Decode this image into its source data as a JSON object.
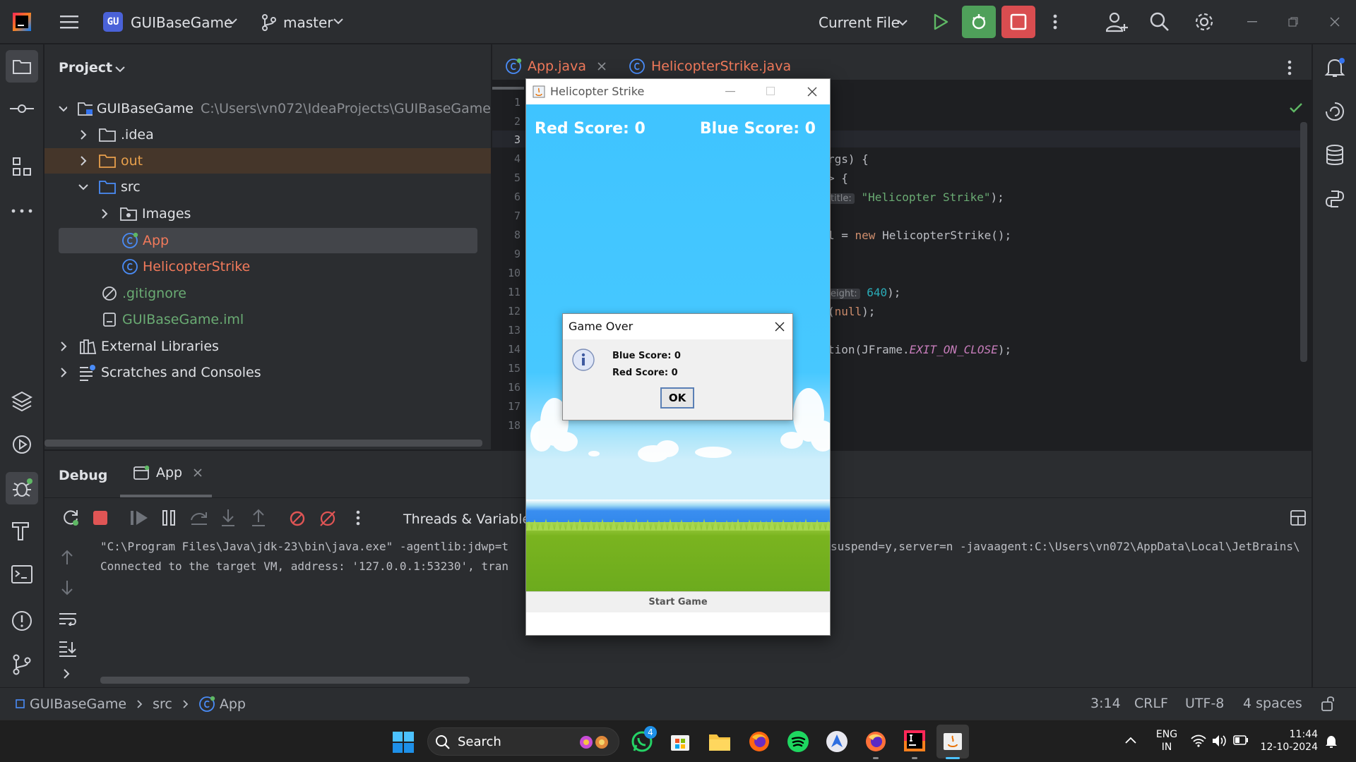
{
  "titlebar": {
    "project_badge": "GU",
    "project_name": "GUIBaseGame",
    "branch": "master",
    "run_config": "Current File"
  },
  "project_panel": {
    "title": "Project",
    "tree": [
      {
        "label": "GUIBaseGame",
        "extra": "C:\\Users\\vn072\\IdeaProjects\\GUIBaseGame",
        "icon": "folder-icon"
      },
      {
        "label": ".idea",
        "icon": "folder-icon"
      },
      {
        "label": "out",
        "icon": "folder-icon",
        "color": "#e8a04c"
      },
      {
        "label": "src",
        "icon": "folder-icon"
      },
      {
        "label": "Images",
        "icon": "package-icon"
      },
      {
        "label": "App",
        "icon": "class-icon",
        "color": "#f27a5b"
      },
      {
        "label": "HelicopterStrike",
        "icon": "class-icon",
        "color": "#f27a5b"
      },
      {
        "label": ".gitignore",
        "icon": "ignore-icon",
        "color": "#6aab73"
      },
      {
        "label": "GUIBaseGame.iml",
        "icon": "file-icon",
        "color": "#6aab73"
      },
      {
        "label": "External Libraries",
        "icon": "library-icon"
      },
      {
        "label": "Scratches and Consoles",
        "icon": "scratches-icon"
      }
    ]
  },
  "editor": {
    "tabs": [
      {
        "label": "App.java"
      },
      {
        "label": "HelicopterStrike.java"
      }
    ],
    "line_numbers": [
      "1",
      "2",
      "3",
      "4",
      "5",
      "6",
      "7",
      "8",
      "9",
      "10",
      "11",
      "12",
      "13",
      "14",
      "15",
      "16",
      "17",
      "18"
    ],
    "code": {
      "l4": "rgs) {",
      "l5": "> {",
      "l6_hint": "title:",
      "l6_str": "\"Helicopter Strike\"",
      "l6_end": ");",
      "l8_a": "l = ",
      "l8_kw": "new",
      "l8_b": " HelicopterStrike();",
      "l11_hint": "eight:",
      "l11_num": "640",
      "l11_end": ");",
      "l12_a": "(",
      "l12_kw": "null",
      "l12_b": ");",
      "l14_a": "tion(JFrame.",
      "l14_fld": "EXIT_ON_CLOSE",
      "l14_b": ");"
    }
  },
  "debug": {
    "title": "Debug",
    "tab": "App",
    "threads_label": "Threads & Variables",
    "console": {
      "line1_left": "\"C:\\Program Files\\Java\\jdk-23\\bin\\java.exe\" -agentlib:jdwp=t",
      "line1_right": "suspend=y,server=n -javaagent:C:\\Users\\vn072\\AppData\\Local\\JetBrains\\",
      "line2": "Connected to the target VM, address: '127.0.0.1:53230', tran"
    }
  },
  "game": {
    "title": "Helicopter Strike",
    "red_score": "Red Score: 0",
    "blue_score": "Blue Score: 0",
    "start_button": "Start Game"
  },
  "dialog": {
    "title": "Game Over",
    "line1": "Blue Score: 0",
    "line2": "Red Score: 0",
    "ok": "OK"
  },
  "statusbar": {
    "breadcrumb": [
      "GUIBaseGame",
      "src",
      "App"
    ],
    "position": "3:14",
    "line_sep": "CRLF",
    "encoding": "UTF-8",
    "indent": "4 spaces"
  },
  "taskbar": {
    "search": "Search",
    "whatsapp_badge": "4",
    "lang1": "ENG",
    "lang2": "IN",
    "time": "11:44",
    "date": "12-10-2024"
  }
}
